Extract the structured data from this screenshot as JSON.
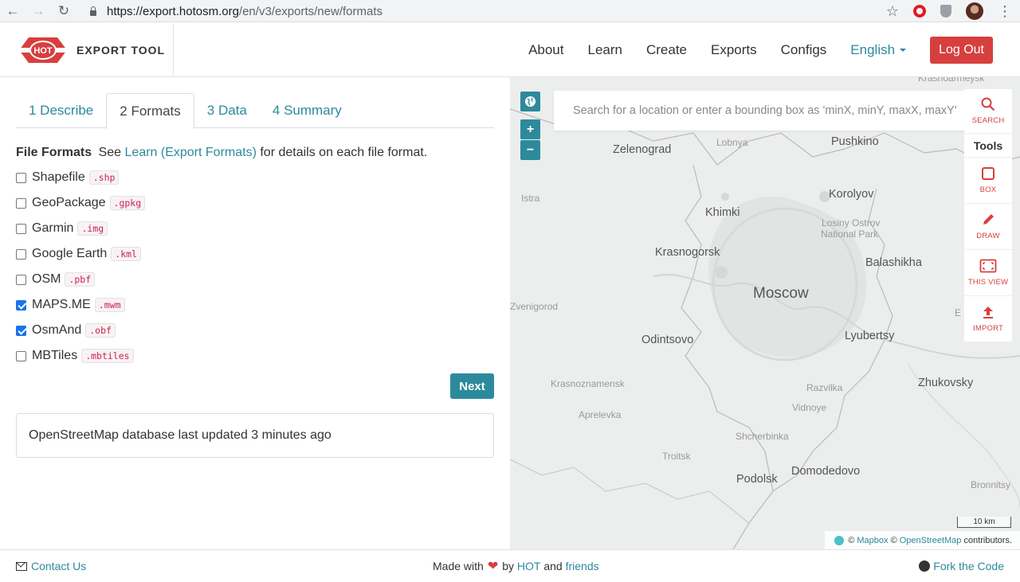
{
  "browser": {
    "url_host": "https://export.hotosm.org",
    "url_path": "/en/v3/exports/new/formats",
    "back_icon": "←",
    "forward_icon": "→",
    "reload_icon": "↻",
    "star_icon": "☆",
    "menu_icon": "⋮"
  },
  "header": {
    "logo_text": "HOT",
    "brand": "EXPORT TOOL",
    "nav": {
      "about": "About",
      "learn": "Learn",
      "create": "Create",
      "exports": "Exports",
      "configs": "Configs",
      "language": "English",
      "logout": "Log Out"
    }
  },
  "tabs": [
    "1 Describe",
    "2 Formats",
    "3 Data",
    "4 Summary"
  ],
  "active_tab": 1,
  "file_formats": {
    "heading": "File Formats",
    "see": "See",
    "link": "Learn (Export Formats)",
    "suffix": "for details on each file format.",
    "items": [
      {
        "label": "Shapefile",
        "ext": ".shp",
        "checked": false
      },
      {
        "label": "GeoPackage",
        "ext": ".gpkg",
        "checked": false
      },
      {
        "label": "Garmin",
        "ext": ".img",
        "checked": false
      },
      {
        "label": "Google Earth",
        "ext": ".kml",
        "checked": false
      },
      {
        "label": "OSM",
        "ext": ".pbf",
        "checked": false
      },
      {
        "label": "MAPS.ME",
        "ext": ".mwm",
        "checked": true
      },
      {
        "label": "OsmAnd",
        "ext": ".obf",
        "checked": true
      },
      {
        "label": "MBTiles",
        "ext": ".mbtiles",
        "checked": false
      }
    ]
  },
  "next_button": "Next",
  "status_text": "OpenStreetMap database last updated 3 minutes ago",
  "map": {
    "zoom_in": "+",
    "zoom_out": "−",
    "search_placeholder": "Search for a location or enter a bounding box as 'minX, minY, maxX, maxY'",
    "tools_heading": "Tools",
    "tools": {
      "search": "SEARCH",
      "box": "BOX",
      "draw": "DRAW",
      "this_view": "THIS VIEW",
      "import": "IMPORT"
    },
    "labels": {
      "krasnoarmeysk": "Krasnoarmeysk",
      "zelenograd": "Zelenograd",
      "lobnya": "Lobnya",
      "pushkino": "Pushkino",
      "istra": "Istra",
      "khimki": "Khimki",
      "korolyov": "Korolyov",
      "losiny": "Losiny Ostrov",
      "national_park": "National Park",
      "krasnogorsk": "Krasnogorsk",
      "balashikha": "Balashikha",
      "moscow": "Moscow",
      "zvenigorod": "Zvenigorod",
      "odintsovo": "Odintsovo",
      "lyubertsy": "Lyubertsy",
      "krasnoznamensk": "Krasnoznamensk",
      "razvilka": "Razvilka",
      "zhukovsky": "Zhukovsky",
      "vidnoye": "Vidnoye",
      "aprelevka": "Aprelevka",
      "shcherbinka": "Shcherbinka",
      "troitsk": "Troitsk",
      "podolsk": "Podolsk",
      "domodedovo": "Domodedovo",
      "bronnitsy": "Bronnitsy",
      "e_partial": "E"
    },
    "scale": "10 km",
    "attribution": {
      "copy1": "©",
      "mapbox": "Mapbox",
      "copy2": "©",
      "osm": "OpenStreetMap",
      "contributors": "contributors."
    }
  },
  "footer": {
    "contact": "Contact Us",
    "made_with": "Made with",
    "heart": "❤",
    "by": "by",
    "hot": "HOT",
    "and": "and",
    "friends": "friends",
    "fork": "Fork the Code"
  },
  "colors": {
    "accent": "#2c8a9c",
    "danger": "#d73f3f",
    "checkbox": "#1a73e8"
  }
}
